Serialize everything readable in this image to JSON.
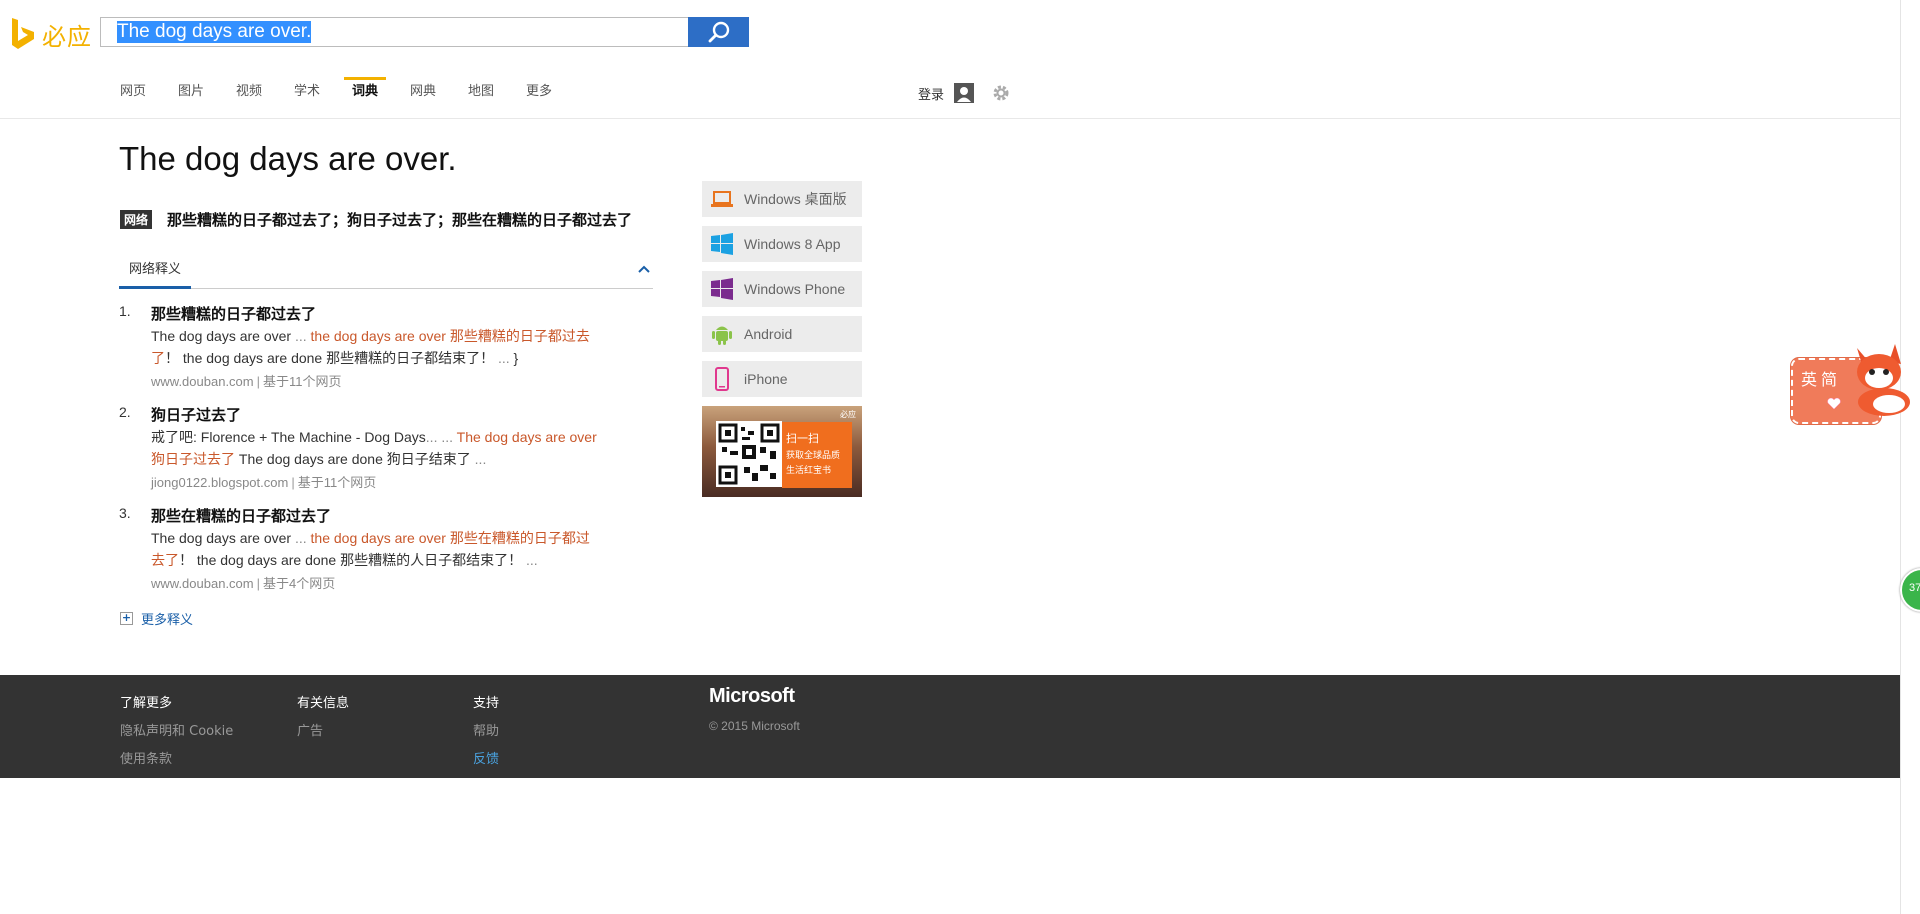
{
  "brand": {
    "name": "必应",
    "color": "#f3b100"
  },
  "search": {
    "value": "The dog days are over.",
    "button_icon": "search-icon"
  },
  "nav": {
    "items": [
      {
        "label": "网页"
      },
      {
        "label": "图片"
      },
      {
        "label": "视频"
      },
      {
        "label": "学术"
      },
      {
        "label": "词典",
        "active": true
      },
      {
        "label": "网典"
      },
      {
        "label": "地图"
      },
      {
        "label": "更多"
      }
    ],
    "login_label": "登录"
  },
  "query": {
    "title": "The dog days are over.",
    "net_badge": "网络",
    "net_translation": "那些糟糕的日子都过去了；狗日子过去了；那些在糟糕的日子都过去了"
  },
  "definitions": {
    "tab_label": "网络释义",
    "items": [
      {
        "num": "1.",
        "head": "那些糟糕的日子都过去了",
        "line1_plain": "The dog days are over ",
        "line1_dots": "...",
        "line1_hl": " the dog days are over 那些糟糕的日子都过去",
        "line2_hl": "了",
        "line2_plain": "！ the dog days are done 那些糟糕的日子都结束了！ ",
        "line2_dots": "...",
        "source": "www.douban.com",
        "based": "基于11个网页"
      },
      {
        "num": "2.",
        "head": "狗日子过去了",
        "line1_plain": "戒了吧: Florence + The Machine - Dog Days",
        "line1_dots": "... ...",
        "line1_hl": " The dog days are over",
        "line2_hl": "狗日子过去了",
        "line2_plain": " The dog days are done 狗日子结束了 ",
        "line2_dots": "...",
        "source": "jiong0122.blogspot.com",
        "based": "基于11个网页"
      },
      {
        "num": "3.",
        "head": "那些在糟糕的日子都过去了",
        "line1_plain": "The dog days are over ",
        "line1_dots": "...",
        "line1_hl": " the dog days are over 那些在糟糕的日子都过",
        "line2_hl": "去了",
        "line2_plain": "！ the dog days are done 那些糟糕的人日子都结束了！ ",
        "line2_dots": "...",
        "source": "www.douban.com",
        "based": "基于4个网页"
      }
    ],
    "more_label": "更多释义"
  },
  "apps": [
    {
      "label": "Windows 桌面版",
      "icon": "laptop-icon",
      "color": "#e8741e"
    },
    {
      "label": "Windows 8 App",
      "icon": "windows-icon",
      "color": "#1ba1e2"
    },
    {
      "label": "Windows Phone",
      "icon": "windows-icon",
      "color": "#7b2b8e"
    },
    {
      "label": "Android",
      "icon": "android-icon",
      "color": "#8bc34a"
    },
    {
      "label": "iPhone",
      "icon": "iphone-icon",
      "color": "#e0388e"
    }
  ],
  "promo": {
    "line1": "扫一扫",
    "line2": "获取全球品质",
    "line3": "生活红宝书",
    "logo": "必应"
  },
  "footer": {
    "col1": {
      "head": "了解更多",
      "links": [
        "隐私声明和 Cookie",
        "使用条款"
      ]
    },
    "col2": {
      "head": "有关信息",
      "links": [
        "广告"
      ]
    },
    "col3": {
      "head": "支持",
      "links": [
        "帮助",
        "反馈"
      ]
    },
    "brand": "Microsoft",
    "copyright": "© 2015 Microsoft"
  },
  "widget": {
    "label": "英简",
    "badge_number": "37"
  }
}
